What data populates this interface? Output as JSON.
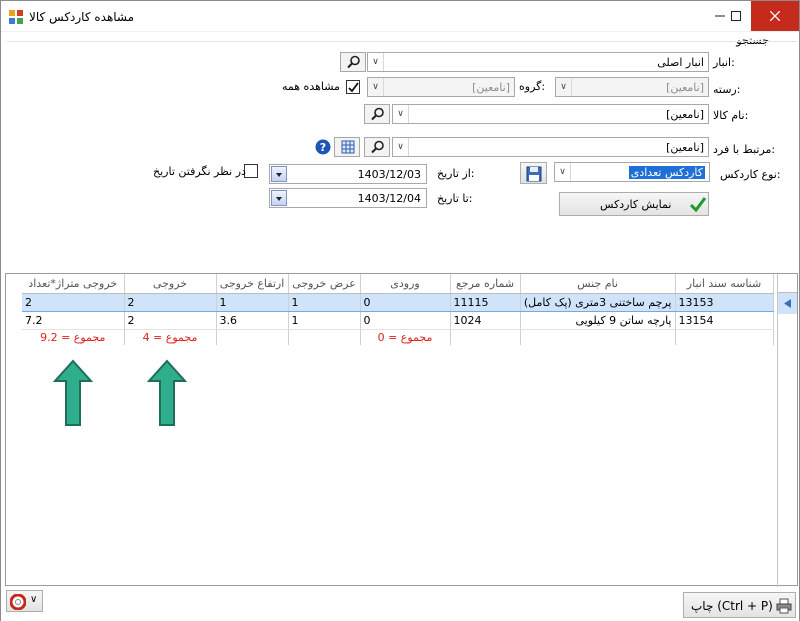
{
  "window": {
    "title": "مشاهده کاردکس کالا"
  },
  "search_group": {
    "label": "جستجو"
  },
  "warehouse": {
    "label": "انبار:",
    "value": "انبار اصلی"
  },
  "category": {
    "label": "رسته:",
    "value": "[نامعین]"
  },
  "group": {
    "label": "گروه:",
    "value": "[نامعین]"
  },
  "show_all": {
    "label": "مشاهده همه",
    "checked": true
  },
  "product": {
    "label": "نام کالا:",
    "value": "[نامعین]"
  },
  "related_person": {
    "label": "مرتبط با فرد:",
    "value": "[نامعین]"
  },
  "kardex_type": {
    "label": "نوع کاردکس:",
    "value": "کاردکس تعدادی"
  },
  "ignore_date": {
    "label": "در نظر نگرفتن تاریخ",
    "checked": false
  },
  "from_date": {
    "label": "از تاریخ:",
    "value": "1403/12/03"
  },
  "to_date": {
    "label": "تا تاریخ:",
    "value": "1403/12/04"
  },
  "show_button": {
    "label": "نمایش کاردکس"
  },
  "table": {
    "columns": [
      "شناسه سند انبار",
      "نام جنس",
      "شماره مرجع",
      "ورودی",
      "عرض خروجی",
      "ارتفاع خروجی",
      "خروجی",
      "خروجی متراژ*تعداد"
    ],
    "rows": [
      [
        "13153",
        "پرچم ساختنی 3متری (پک کامل)",
        "11115",
        "0",
        "1",
        "1",
        "2",
        "2"
      ],
      [
        "13154",
        "پارچه ساتن 9 کیلویی",
        "1024",
        "0",
        "1",
        "3.6",
        "2",
        "7.2"
      ]
    ],
    "sums": {
      "input": "مجموع = 0",
      "output": "مجموع = 4",
      "area_output": "مجموع = 9.2"
    }
  },
  "print_button": {
    "label": "چاپ (Ctrl + P)"
  },
  "colors": {
    "sum_text": "#e0201d",
    "arrow_fill": "#2fae8e",
    "selected_row": "#cfe3fa"
  }
}
